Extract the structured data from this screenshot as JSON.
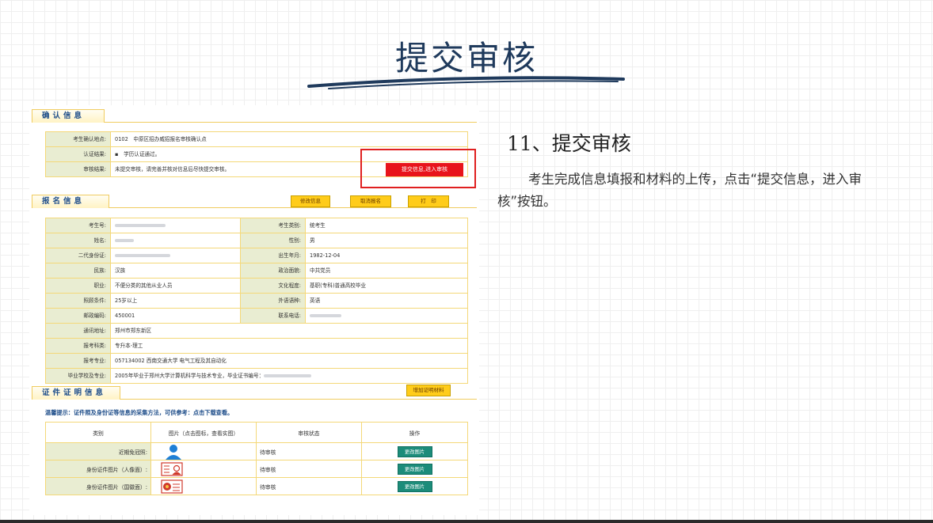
{
  "slide": {
    "title": "提交审核",
    "step_title": "11、提交审核",
    "description": "考生完成信息填报和材料的上传，点击“提交信息，进入审核”按钮。"
  },
  "confirm": {
    "header": "确认信息",
    "rows": [
      {
        "label": "考生确认地点:",
        "value": "0102　中原区招办威招报名审核确认点"
      },
      {
        "label": "认证结果:",
        "value": "▪　学历认证通过。"
      },
      {
        "label": "审核结果:",
        "value": "未提交审核，请完善并核对信息后尽快提交审核。"
      }
    ],
    "submit_button": "提交信息,进入审核"
  },
  "registration": {
    "header": "报名信息",
    "buttons": {
      "edit": "修改信息",
      "cancel": "取消报名",
      "print": "打　印"
    },
    "rows": [
      {
        "l1": "考生号:",
        "v1": "",
        "l2": "考生类别:",
        "v2": "统考生"
      },
      {
        "l1": "姓名:",
        "v1": "",
        "l2": "性别:",
        "v2": "男"
      },
      {
        "l1": "二代身份证:",
        "v1": "",
        "l2": "出生年月:",
        "v2": "1982-12-04"
      },
      {
        "l1": "民族:",
        "v1": "汉族",
        "l2": "政治面貌:",
        "v2": "中共党员"
      },
      {
        "l1": "职业:",
        "v1": "不便分类的其他从业人员",
        "l2": "文化程度:",
        "v2": "基职(专科)普通高校毕业"
      },
      {
        "l1": "照顾条件:",
        "v1": "25岁以上",
        "l2": "外语语种:",
        "v2": "英语"
      },
      {
        "l1": "邮政编码:",
        "v1": "450001",
        "l2": "联系电话:",
        "v2": ""
      }
    ],
    "wide_rows": [
      {
        "label": "通讯地址:",
        "value": "郑州市郑东新区"
      },
      {
        "label": "报考科类:",
        "value": "专升本-理工"
      },
      {
        "label": "报考专业:",
        "value": "057134002 西南交通大学 电气工程及其自动化"
      },
      {
        "label": "毕业学校及专业:",
        "value": "2005年毕业于郑州大学计算机科学与技术专业，毕业证书编号："
      }
    ]
  },
  "certificates": {
    "header": "证件证明信息",
    "add_button": "增加证明材料",
    "tip_head": "温馨提示：",
    "tip_body": "证件照及身份证等信息的采集方法，可供参考：点击下载查看。",
    "columns": [
      "类别",
      "图片（点击图标，查看实图）",
      "审核状态",
      "操作"
    ],
    "rows": [
      {
        "category": "近期免冠照:",
        "status": "待审核",
        "action": "更改图片"
      },
      {
        "category": "身份证件图片（人像面）:",
        "status": "待审核",
        "action": "更改图片"
      },
      {
        "category": "身份证件图片（国徽面）:",
        "status": "待审核",
        "action": "更改图片"
      }
    ]
  },
  "colors": {
    "title": "#1f3a5c",
    "submit": "#e8141b",
    "highlight": "#e02020",
    "action": "#1c8c7a",
    "button": "#ffcc1a"
  }
}
